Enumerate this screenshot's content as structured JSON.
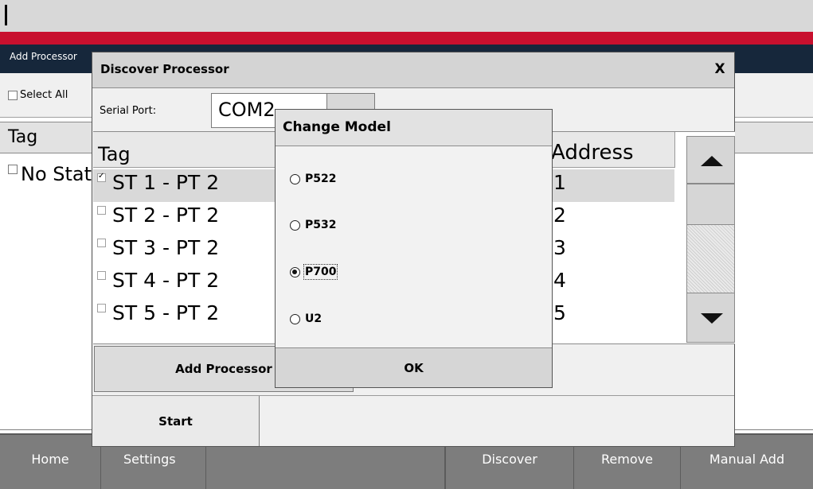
{
  "background": {
    "page_title": "Add Processor",
    "select_all_label": "Select All",
    "grid_header_tag": "Tag",
    "grid_row_text": "No Stations"
  },
  "footer": {
    "home": "Home",
    "settings": "Settings",
    "discover": "Discover",
    "remove": "Remove",
    "manual_add": "Manual Add"
  },
  "discover_dialog": {
    "title": "Discover Processor",
    "close": "X",
    "serial_port_label": "Serial Port:",
    "serial_port_value": "COM2",
    "columns": {
      "tag": "Tag",
      "address": "Address"
    },
    "rows": [
      {
        "tag": "ST 1 - PT 2",
        "address": "1",
        "checked": true
      },
      {
        "tag": "ST 2 - PT 2",
        "address": "2",
        "checked": false
      },
      {
        "tag": "ST 3 - PT 2",
        "address": "3",
        "checked": false
      },
      {
        "tag": "ST 4 - PT 2",
        "address": "4",
        "checked": false
      },
      {
        "tag": "ST 5 - PT 2",
        "address": "5",
        "checked": false
      }
    ],
    "add_processor_button": "Add Processor",
    "start_button": "Start"
  },
  "change_model_dialog": {
    "title": "Change Model",
    "options": [
      {
        "label": "P522",
        "selected": false
      },
      {
        "label": "P532",
        "selected": false
      },
      {
        "label": "P700",
        "selected": true
      },
      {
        "label": "U2",
        "selected": false
      }
    ],
    "ok_button": "OK"
  }
}
